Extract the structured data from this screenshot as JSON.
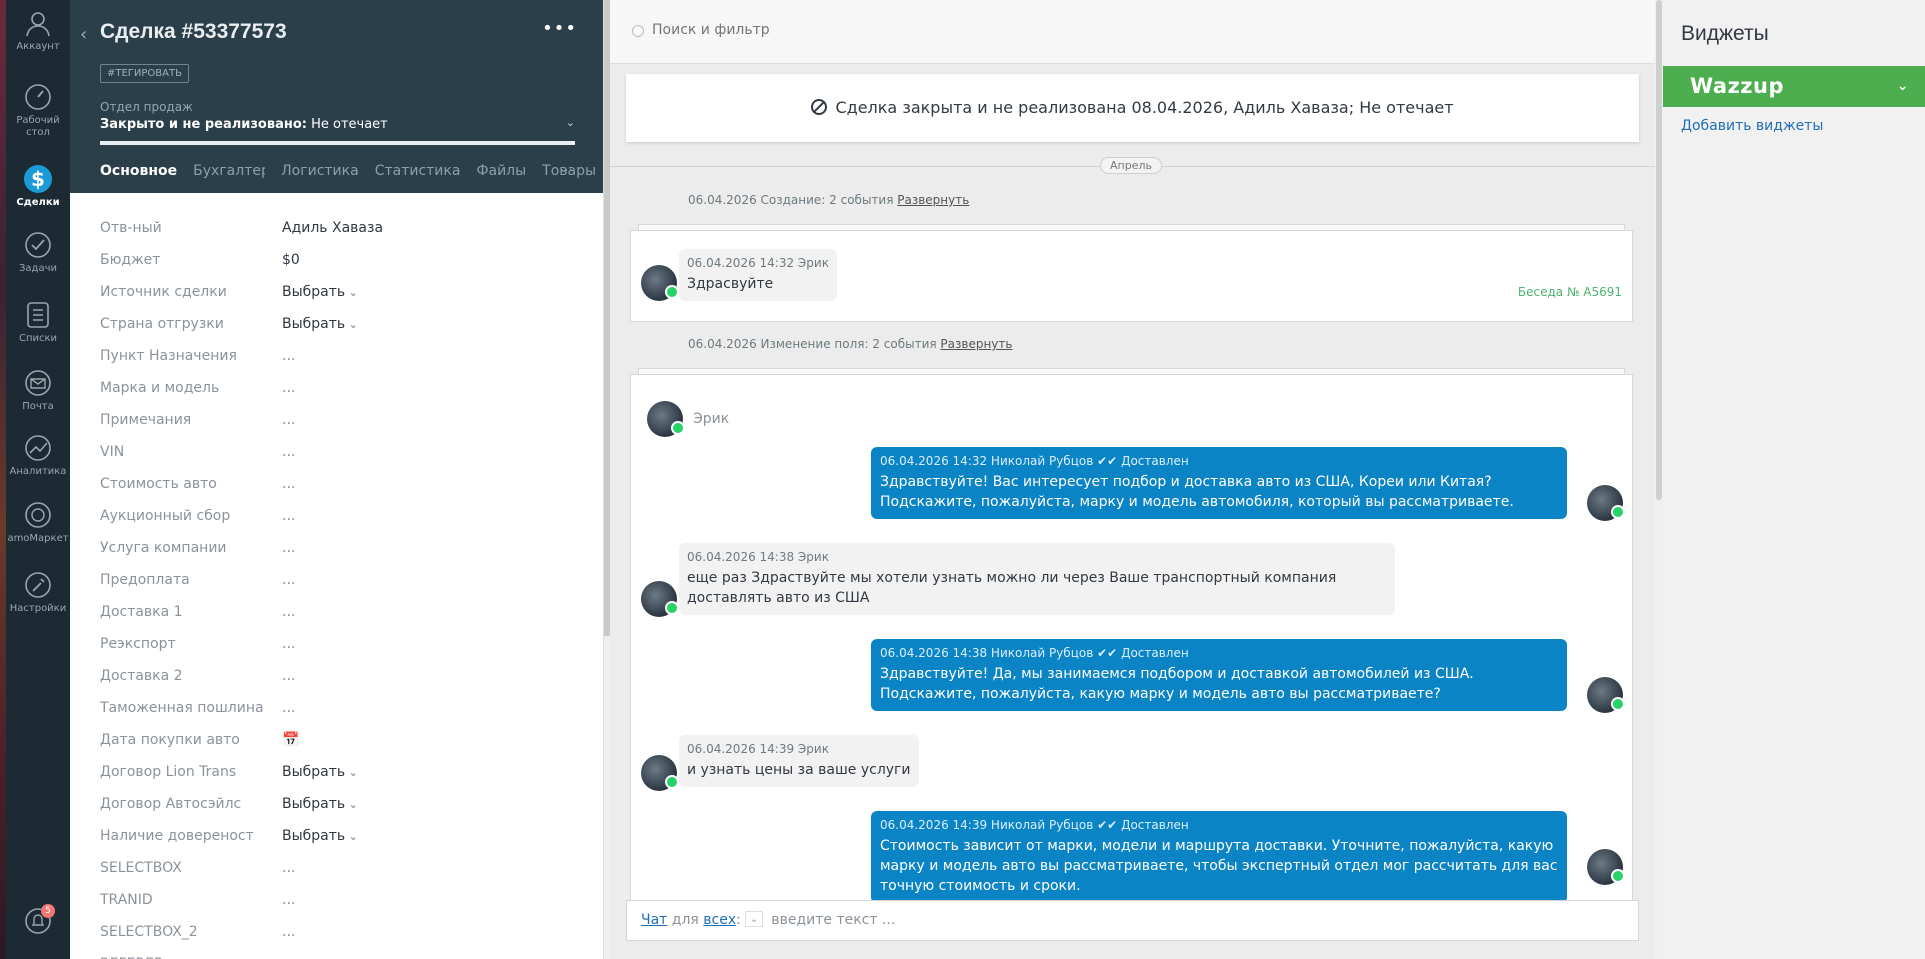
{
  "nav": {
    "items": [
      {
        "label": "Аккаунт"
      },
      {
        "label": "Рабочий стол"
      },
      {
        "label": "Сделки"
      },
      {
        "label": "Задачи"
      },
      {
        "label": "Списки"
      },
      {
        "label": "Почта"
      },
      {
        "label": "Аналитика"
      },
      {
        "label": "amoМаркет"
      },
      {
        "label": "Настройки"
      }
    ],
    "notifications_count": "5"
  },
  "lead": {
    "title": "Сделка #53377573",
    "tag_button": "#ТЕГИРОВАТЬ",
    "pipeline_label": "Отдел продаж",
    "status_bold": "Закрыто и не реализовано:",
    "status_reason": " Не отечает",
    "tabs": [
      {
        "label": "Основное"
      },
      {
        "label": "Бухгалтер"
      },
      {
        "label": "Логистика"
      },
      {
        "label": "Статистика"
      },
      {
        "label": "Файлы"
      },
      {
        "label": "Товары"
      }
    ],
    "tabs_more": "···",
    "fields": [
      {
        "label": "Отв-ный",
        "value": "Адиль Хаваза"
      },
      {
        "label": "Бюджет",
        "value": "$0"
      },
      {
        "label": "Источник сделки",
        "value": "Выбрать"
      },
      {
        "label": "Страна отгрузки",
        "value": "Выбрать"
      },
      {
        "label": "Пункт Назначения",
        "value": "..."
      },
      {
        "label": "Марка и модель",
        "value": "..."
      },
      {
        "label": "Примечания",
        "value": "..."
      },
      {
        "label": "VIN",
        "value": "..."
      },
      {
        "label": "Стоимость авто",
        "value": "..."
      },
      {
        "label": "Аукционный сбор",
        "value": "..."
      },
      {
        "label": "Услуга компании",
        "value": "..."
      },
      {
        "label": "Предоплата",
        "value": "..."
      },
      {
        "label": "Доставка 1",
        "value": "..."
      },
      {
        "label": "Реэкспорт",
        "value": "..."
      },
      {
        "label": "Доставка 2",
        "value": "..."
      },
      {
        "label": "Таможенная пошлина",
        "value": "..."
      },
      {
        "label": "Дата покупки авто",
        "value": "📅"
      },
      {
        "label": "Договор Lion Trans",
        "value": "Выбрать"
      },
      {
        "label": "Договор Автосэйлс",
        "value": "Выбрать"
      },
      {
        "label": "Наличие довереност",
        "value": "Выбрать"
      },
      {
        "label": "SELECTBOX",
        "value": "..."
      },
      {
        "label": "TRANID",
        "value": "..."
      },
      {
        "label": "SELECTBOX_2",
        "value": "..."
      },
      {
        "label": "REFERER",
        "value": ""
      }
    ]
  },
  "feed": {
    "search_placeholder": "Поиск и фильтр",
    "closed_banner": "Сделка закрыта и не реализована 08.04.2026, Адиль Хаваза; Не отечает",
    "month": "Апрель",
    "group1_text": "06.04.2026 Создание: 2 события ",
    "group1_link": "Развернуть",
    "msg1": {
      "meta": "06.04.2026 14:32 Эрик",
      "text": "Здрасвуйте"
    },
    "conversation_link": "Беседа № A5691",
    "group2_text": "06.04.2026 Изменение поля: 2 события ",
    "group2_link": "Развернуть",
    "contact_name": "Эрик",
    "messages": [
      {
        "meta": "06.04.2026 14:32 Николай Рубцов",
        "status": "Доставлен",
        "text": "Здравствуйте! Вас интересует подбор и доставка авто из США, Кореи или Китая? Подскажите, пожалуйста, марку и модель автомобиля, который вы рассматриваете."
      },
      {
        "meta": "06.04.2026 14:38 Эрик",
        "text": "еще раз Здраствуйте мы хотели узнать можно ли через Ваше транспортный компания доставлять авто из США"
      },
      {
        "meta": "06.04.2026 14:38 Николай Рубцов",
        "status": "Доставлен",
        "text": "Здравствуйте! Да, мы занимаемся подбором и доставкой автомобилей из США. Подскажите, пожалуйста, какую марку и модель авто вы рассматриваете?"
      },
      {
        "meta": "06.04.2026 14:39 Эрик",
        "text": "и узнать цены за ваше услуги"
      },
      {
        "meta": "06.04.2026 14:39 Николай Рубцов",
        "status": "Доставлен",
        "text": "Стоимость зависит от марки, модели и маршрута доставки. Уточните, пожалуйста, какую марку и модель авто вы рассматриваете, чтобы экспертный отдел мог рассчитать для вас точную стоимость и сроки."
      }
    ],
    "composer": {
      "chat": "Чат",
      "for": " для ",
      "all": "всех",
      "colon": ":",
      "placeholder": " введите текст ..."
    }
  },
  "widgets": {
    "title": "Виджеты",
    "wazzup": "Wazzup",
    "add_link": "Добавить виджеты"
  },
  "colors": {
    "nav_bg": "#1c2a33",
    "header_bg": "#2b3f4a",
    "outgoing_bubble": "#0b84c6",
    "whatsapp": "#25d366",
    "wazzup_green": "#4cae4e",
    "link_blue": "#1f6fb5"
  }
}
